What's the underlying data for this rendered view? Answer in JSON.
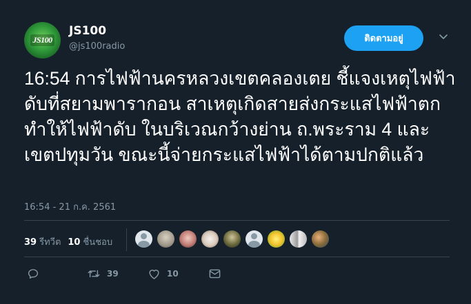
{
  "account": {
    "name": "JS100",
    "handle": "@js100radio",
    "avatar_logo": "JS100"
  },
  "follow_button": {
    "label": "ติดตามอยู่"
  },
  "tweet": {
    "text": "16:54  การไฟฟ้านครหลวงเขตคลองเตย ชี้แจงเหตุไฟฟ้าดับที่สยามพารากอน สาเหตุเกิดสายส่งกระแสไฟฟ้าตก ทำให้ไฟฟ้าดับ ในบริเวณกว้างย่าน ถ.พระราม 4  และเขตปทุมวัน ขณะนี้จ่ายกระแสไฟฟ้าได้ตามปกติแล้ว",
    "timestamp": "16:54 - 21 ก.ค. 2561"
  },
  "stats": {
    "retweets_count": "39",
    "retweets_label": "รีทวีต",
    "likes_count": "10",
    "likes_label": "ชื่นชอบ"
  },
  "liker_avatars": [
    "default-avatar-1",
    "photo-avatar-2",
    "photo-avatar-3",
    "photo-avatar-4",
    "photo-avatar-5",
    "default-avatar-6",
    "cartoon-avatar-7",
    "photo-avatar-8",
    "photo-avatar-9"
  ],
  "actions": {
    "reply_icon": "reply-icon",
    "retweet_icon": "retweet-icon",
    "retweet_count": "39",
    "like_icon": "heart-icon",
    "like_count": "10",
    "message_icon": "envelope-icon"
  },
  "colors": {
    "background": "#15202b",
    "accent": "#1da1f2",
    "muted_text": "#8899a6",
    "divider": "#38444d"
  }
}
